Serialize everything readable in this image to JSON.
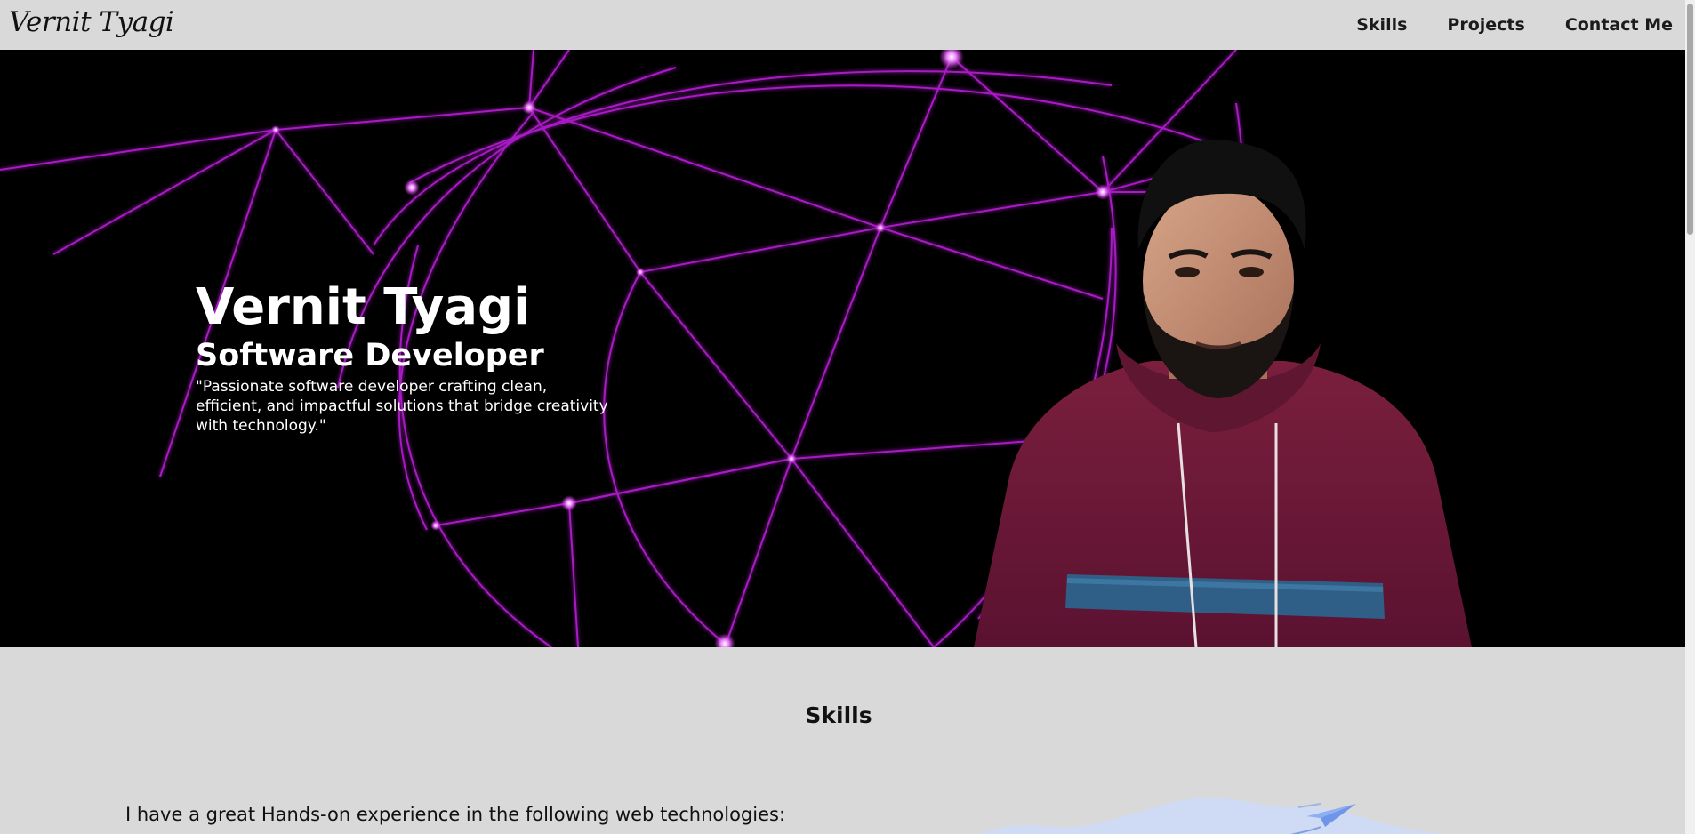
{
  "navbar": {
    "brand": "Vernit Tyagi",
    "links": [
      {
        "label": "Skills"
      },
      {
        "label": "Projects"
      },
      {
        "label": "Contact Me"
      }
    ]
  },
  "hero": {
    "name": "Vernit Tyagi",
    "role": "Software Developer",
    "quote": "\"Passionate software developer crafting clean, efficient, and impactful solutions that bridge creativity with technology.\"",
    "background": "#000000",
    "accent_color": "#c026d3",
    "icons": {
      "background": "network-globe-icon",
      "portrait": "portrait-photo"
    }
  },
  "skills": {
    "title": "Skills",
    "intro": "I have a great Hands-on experience in the following web technologies:",
    "illustration": "paper-plane-illustration"
  },
  "colors": {
    "page_bg": "#d9d9d9",
    "text": "#111111",
    "hero_text": "#ffffff"
  }
}
